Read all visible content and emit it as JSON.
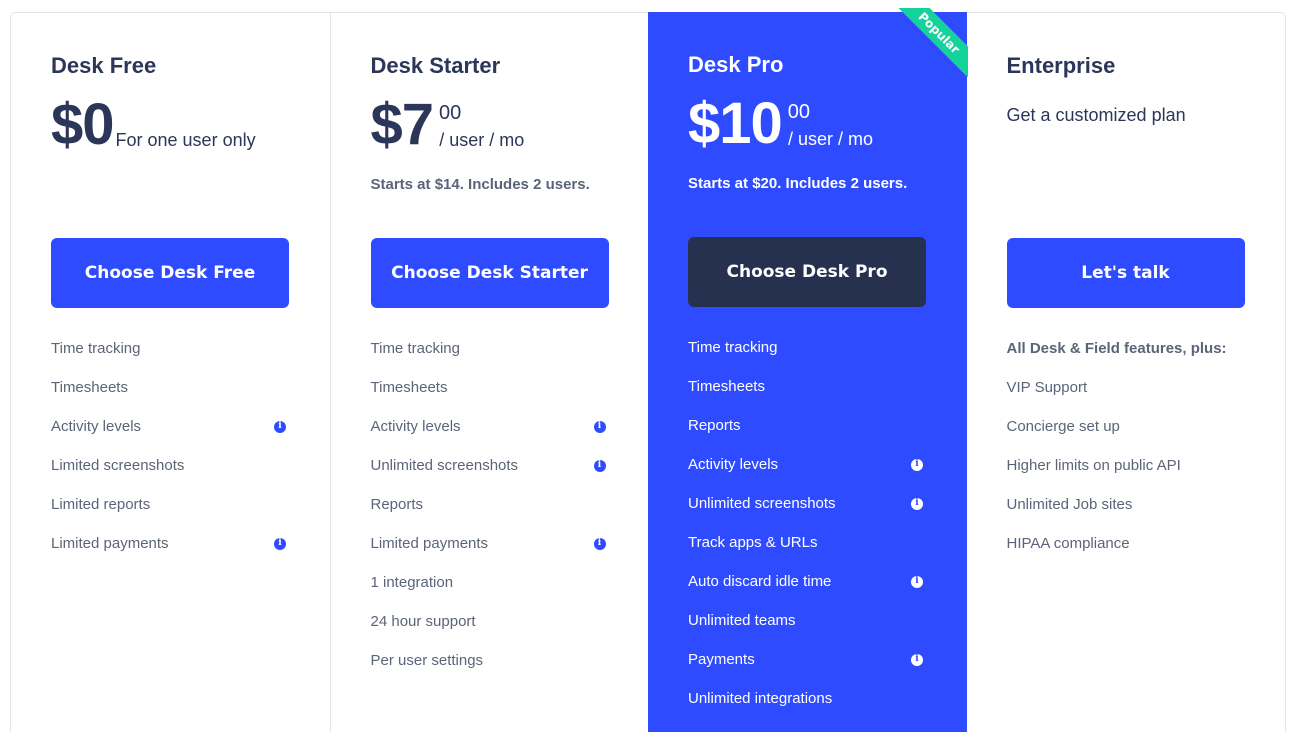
{
  "plans": [
    {
      "name": "Desk Free",
      "price": "$0",
      "note": "For one user only",
      "cta": "Choose Desk Free",
      "features": [
        {
          "label": "Time tracking",
          "info": false
        },
        {
          "label": "Timesheets",
          "info": false
        },
        {
          "label": "Activity levels",
          "info": true
        },
        {
          "label": "Limited screenshots",
          "info": false
        },
        {
          "label": "Limited reports",
          "info": false
        },
        {
          "label": "Limited payments",
          "info": true
        }
      ]
    },
    {
      "name": "Desk Starter",
      "price": "$7",
      "cents": "00",
      "unit": "/ user / mo",
      "starts": "Starts at $14. Includes 2 users.",
      "cta": "Choose Desk Starter",
      "features": [
        {
          "label": "Time tracking",
          "info": false
        },
        {
          "label": "Timesheets",
          "info": false
        },
        {
          "label": "Activity levels",
          "info": true
        },
        {
          "label": "Unlimited screenshots",
          "info": true
        },
        {
          "label": "Reports",
          "info": false
        },
        {
          "label": "Limited payments",
          "info": true
        },
        {
          "label": "1 integration",
          "info": false
        },
        {
          "label": "24 hour support",
          "info": false
        },
        {
          "label": "Per user settings",
          "info": false
        }
      ]
    },
    {
      "name": "Desk Pro",
      "badge": "Popular",
      "price": "$10",
      "cents": "00",
      "unit": "/ user / mo",
      "starts": "Starts at $20. Includes 2 users.",
      "cta": "Choose Desk Pro",
      "features": [
        {
          "label": "Time tracking",
          "info": false
        },
        {
          "label": "Timesheets",
          "info": false
        },
        {
          "label": "Reports",
          "info": false
        },
        {
          "label": "Activity levels",
          "info": true
        },
        {
          "label": "Unlimited screenshots",
          "info": true
        },
        {
          "label": "Track apps & URLs",
          "info": false
        },
        {
          "label": "Auto discard idle time",
          "info": true
        },
        {
          "label": "Unlimited teams",
          "info": false
        },
        {
          "label": "Payments",
          "info": true
        },
        {
          "label": "Unlimited integrations",
          "info": false
        }
      ]
    },
    {
      "name": "Enterprise",
      "note": "Get a customized plan",
      "cta": "Let's talk",
      "features": [
        {
          "label": "All Desk & Field features, plus:",
          "info": false
        },
        {
          "label": "VIP Support",
          "info": false
        },
        {
          "label": "Concierge set up",
          "info": false
        },
        {
          "label": "Higher limits on public API",
          "info": false
        },
        {
          "label": "Unlimited Job sites",
          "info": false
        },
        {
          "label": "HIPAA compliance",
          "info": false
        }
      ]
    }
  ],
  "info_glyph": "i",
  "colors": {
    "brand": "#2e4bff",
    "dark": "#263150",
    "badge": "#14d39a",
    "text": "#2b3658",
    "muted": "#5b6478"
  }
}
